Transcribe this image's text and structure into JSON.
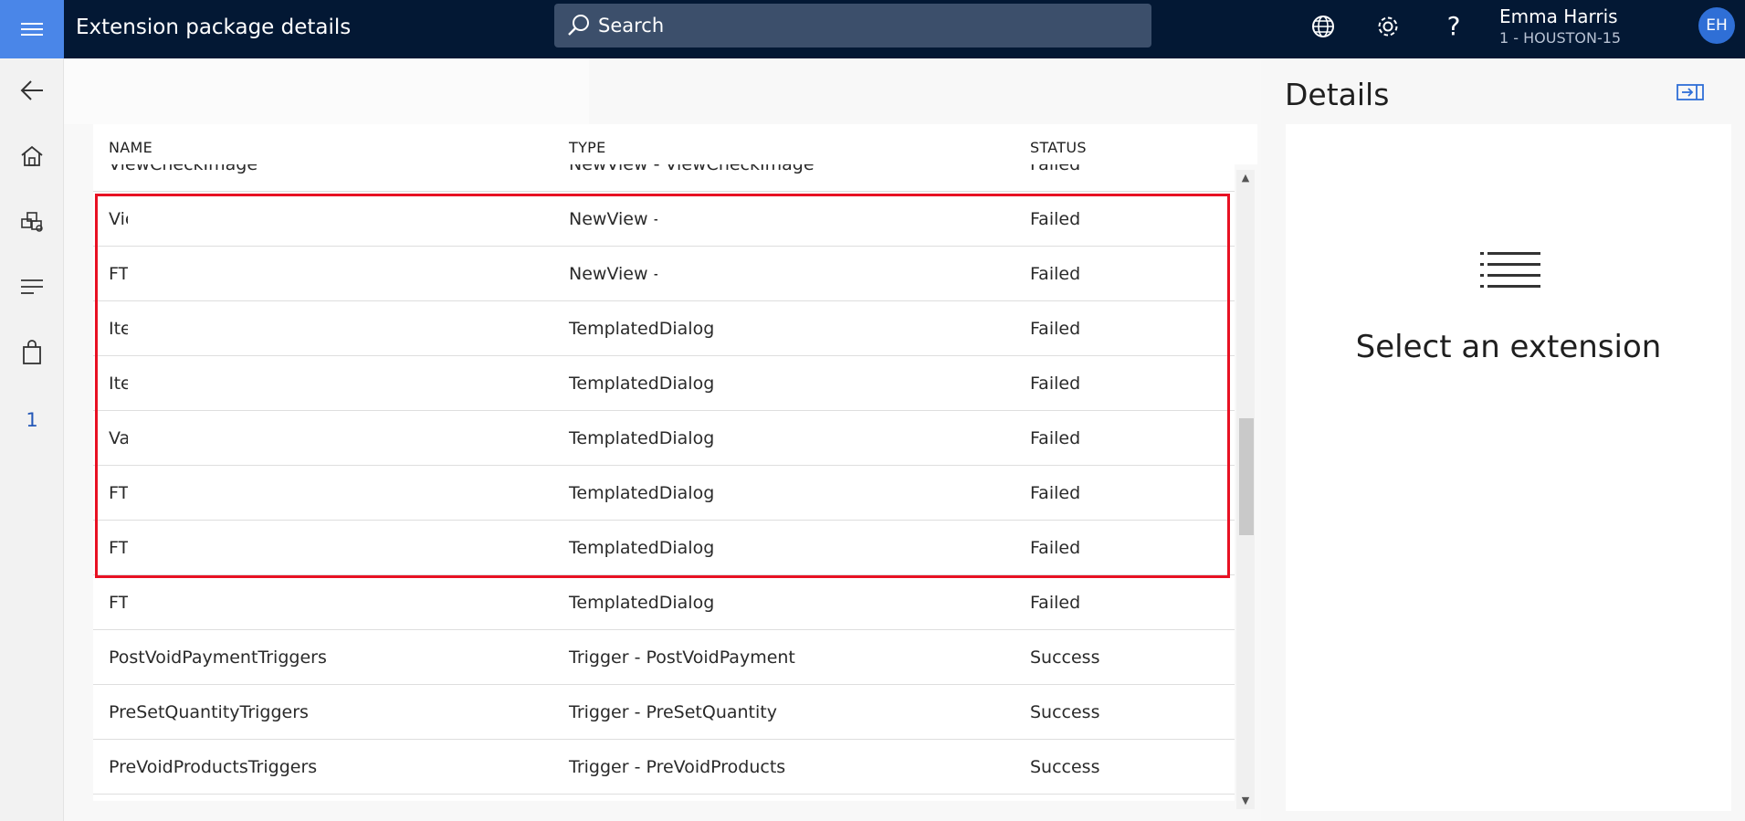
{
  "header": {
    "title": "Extension package details",
    "search_label": "Search",
    "user_name": "Emma Harris",
    "store": "1 - HOUSTON-15",
    "avatar_initials": "EH"
  },
  "sidebar": {
    "icons": [
      "back-arrow-icon",
      "home-icon",
      "products-icon",
      "menu-list-icon",
      "shopping-bag-icon"
    ],
    "badge_number": "1"
  },
  "table": {
    "columns": [
      "NAME",
      "TYPE",
      "STATUS"
    ],
    "partial_row": {
      "name": "ViewCheckImage",
      "type": "NewView - ViewCheckImage",
      "status": "Failed"
    },
    "rows": [
      {
        "name": "Vie",
        "type": "NewView -",
        "status": "Failed"
      },
      {
        "name": "FT",
        "type": "NewView -",
        "status": "Failed"
      },
      {
        "name": "Ite",
        "type": "TemplatedDialog",
        "status": "Failed"
      },
      {
        "name": "Ite",
        "type": "TemplatedDialog",
        "status": "Failed"
      },
      {
        "name": "Va",
        "type": "TemplatedDialog",
        "status": "Failed"
      },
      {
        "name": "FT",
        "type": "TemplatedDialog",
        "status": "Failed"
      },
      {
        "name": "FT",
        "type": "TemplatedDialog",
        "status": "Failed"
      },
      {
        "name": "FT",
        "type": "TemplatedDialog",
        "status": "Failed"
      },
      {
        "name": "PostVoidPaymentTriggers",
        "type": "Trigger - PostVoidPayment",
        "status": "Success"
      },
      {
        "name": "PreSetQuantityTriggers",
        "type": "Trigger - PreSetQuantity",
        "status": "Success"
      },
      {
        "name": "PreVoidProductsTriggers",
        "type": "Trigger - PreVoidProducts",
        "status": "Success"
      }
    ]
  },
  "details": {
    "title": "Details",
    "empty_message": "Select an extension"
  },
  "colors": {
    "topbar": "#031834",
    "accent": "#4a86e8",
    "highlight": "#e81123"
  }
}
